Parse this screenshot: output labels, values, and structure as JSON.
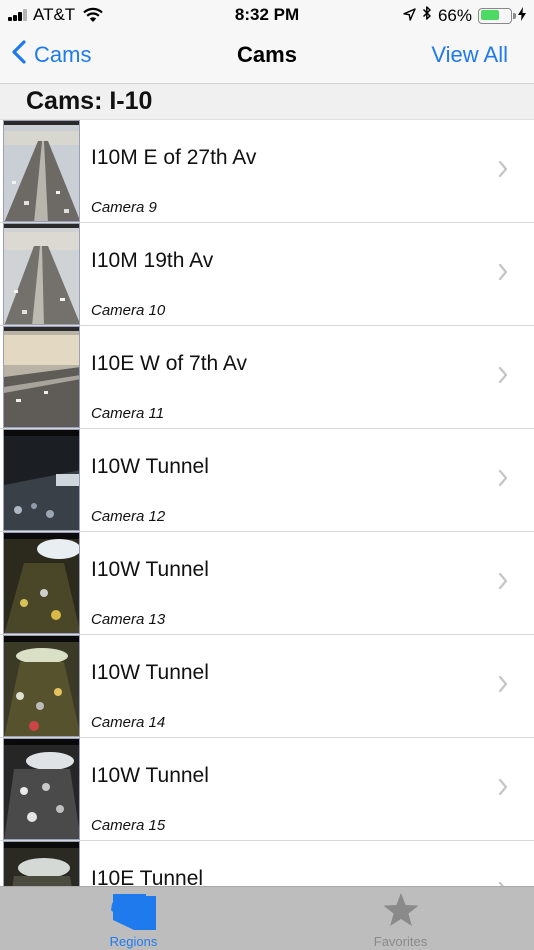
{
  "status_bar": {
    "carrier": "AT&T",
    "time": "8:32 PM",
    "battery_percent": "66%",
    "battery_level": 0.66
  },
  "nav": {
    "back_label": "Cams",
    "title": "Cams",
    "right_label": "View All",
    "accent_color": "#1f7aee"
  },
  "section": {
    "header": "Cams: I-10"
  },
  "cameras": [
    {
      "title": "I10M E of 27th Av",
      "subtitle": "Camera 9"
    },
    {
      "title": "I10M 19th Av",
      "subtitle": "Camera 10"
    },
    {
      "title": "I10E W of 7th Av",
      "subtitle": "Camera 11"
    },
    {
      "title": "I10W Tunnel",
      "subtitle": "Camera 12"
    },
    {
      "title": "I10W Tunnel",
      "subtitle": "Camera 13"
    },
    {
      "title": "I10W Tunnel",
      "subtitle": "Camera 14"
    },
    {
      "title": "I10W Tunnel",
      "subtitle": "Camera 15"
    },
    {
      "title": "I10E Tunnel",
      "subtitle": ""
    }
  ],
  "tab_bar": {
    "tabs": [
      {
        "label": "Regions",
        "icon": "arizona-map-icon",
        "selected": true
      },
      {
        "label": "Favorites",
        "icon": "star-icon",
        "selected": false
      }
    ]
  }
}
